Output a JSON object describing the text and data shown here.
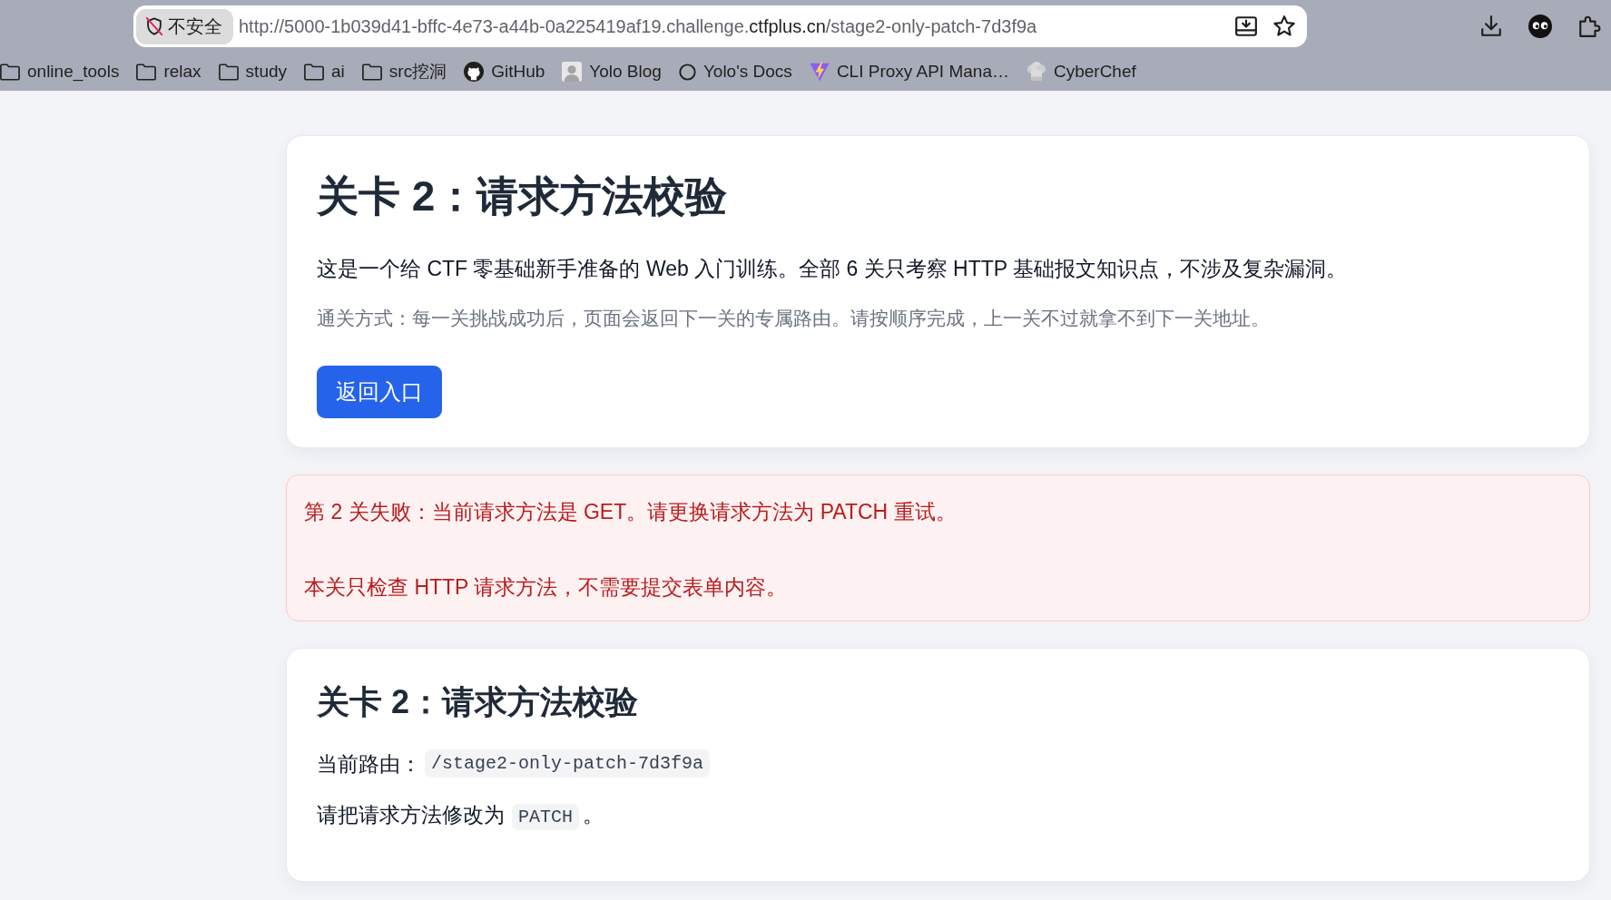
{
  "browser": {
    "security_label": "不安全",
    "url": {
      "prefix": "http://5000-1b039d41-bffc-4e73-a44b-0a225419af19.challenge.",
      "domain": "ctfplus.cn",
      "path": "/stage2-only-patch-7d3f9a"
    }
  },
  "bookmarks": [
    {
      "kind": "folder",
      "label": "online_tools"
    },
    {
      "kind": "folder",
      "label": "relax"
    },
    {
      "kind": "folder",
      "label": "study"
    },
    {
      "kind": "folder",
      "label": "ai"
    },
    {
      "kind": "folder",
      "label": "src挖洞"
    },
    {
      "kind": "cat",
      "label": "GitHub"
    },
    {
      "kind": "avatar",
      "label": "Yolo Blog"
    },
    {
      "kind": "ring",
      "label": "Yolo's Docs"
    },
    {
      "kind": "bolt",
      "label": "CLI Proxy API Mana…"
    },
    {
      "kind": "hat",
      "label": "CyberChef"
    }
  ],
  "intro_card": {
    "title": "关卡 2：请求方法校验",
    "description": "这是一个给 CTF 零基础新手准备的 Web 入门训练。全部 6 关只考察 HTTP 基础报文知识点，不涉及复杂漏洞。",
    "hint": "通关方式：每一关挑战成功后，页面会返回下一关的专属路由。请按顺序完成，上一关不过就拿不到下一关地址。",
    "button": "返回入口"
  },
  "alert": {
    "lines": [
      "第 2 关失败：当前请求方法是 GET。请更换请求方法为 PATCH 重试。",
      "本关只检查 HTTP 请求方法，不需要提交表单内容。"
    ]
  },
  "task_card": {
    "title": "关卡 2：请求方法校验",
    "route_label": "当前路由：",
    "route": "/stage2-only-patch-7d3f9a",
    "instruction": {
      "before": "请把请求方法修改为",
      "code": "PATCH",
      "after": "。"
    }
  }
}
